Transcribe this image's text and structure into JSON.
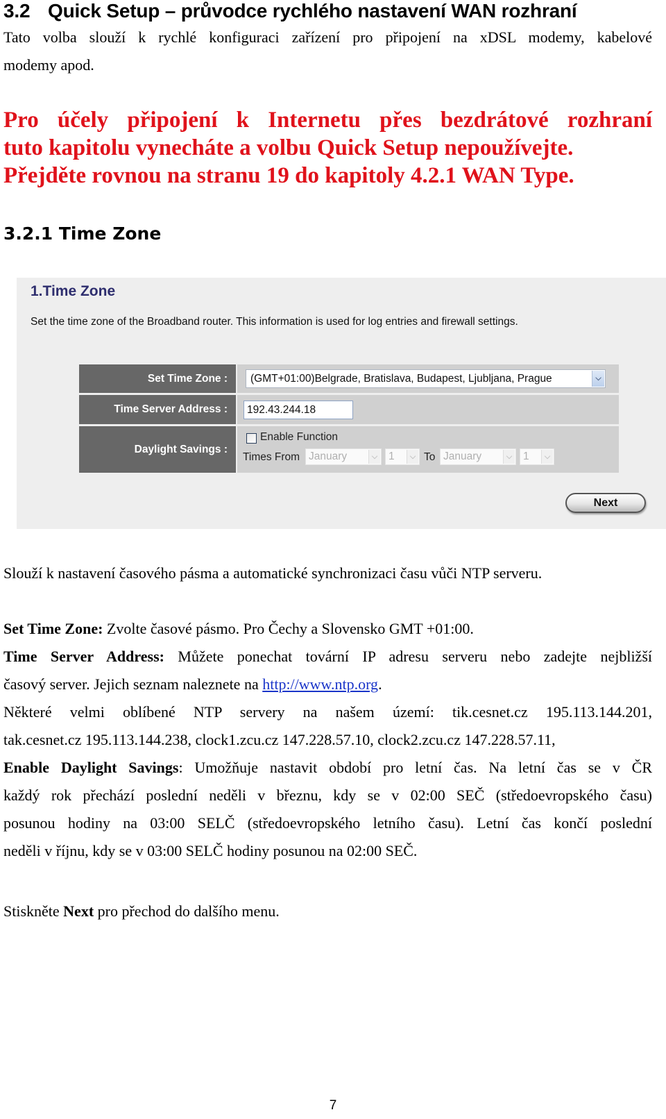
{
  "heading": {
    "number": "3.2",
    "title": "Quick Setup – průvodce rychlého nastavení WAN rozhraní"
  },
  "intro": {
    "line1": "Tato volba slouží k rychlé konfiguraci zařízení pro připojení na xDSL modemy, kabelové",
    "line2": "modemy apod."
  },
  "warning": {
    "line1": "Pro účely připojení k Internetu přes bezdrátové rozhraní",
    "line2": "tuto kapitolu vynecháte a volbu Quick Setup nepoužívejte.",
    "line3": "Přejděte rovnou na stranu 19 do kapitoly 4.2.1 WAN Type.",
    "color": "#e0121b"
  },
  "subheading": "3.2.1 Time Zone",
  "router_ui": {
    "title": "1.Time Zone",
    "description": "Set the time zone of the Broadband router. This information is used for log entries and firewall settings.",
    "rows": {
      "time_zone": {
        "label": "Set Time Zone :",
        "value": "(GMT+01:00)Belgrade, Bratislava, Budapest, Ljubljana, Prague"
      },
      "time_server": {
        "label": "Time Server Address :",
        "value": "192.43.244.18"
      },
      "daylight": {
        "label": "Daylight Savings :",
        "enable_label": "Enable Function",
        "enabled": false,
        "times_from_label": "Times From",
        "to_label": "To",
        "from_month": "January",
        "from_day": "1",
        "to_month": "January",
        "to_day": "1"
      }
    },
    "next_button": "Next",
    "colors": {
      "label_bg": "#676767",
      "value_bg": "#d0d0d0",
      "panel_bg": "#eeeeee",
      "title": "#2e2e6e"
    }
  },
  "body": {
    "p1": "Slouží k nastavení časového pásma a automatické synchronizaci času vůči NTP serveru.",
    "tz_term": "Set Time Zone:",
    "tz_text": " Zvolte časové pásmo. Pro Čechy a Slovensko GMT +01:00.",
    "ts_term": "Time Server Address:",
    "ts_text1": " Můžete ponechat tovární IP adresu serveru nebo zadejte nejbližší",
    "ts_text2": "časový server. Jejich seznam naleznete na ",
    "ts_link": "http://www.ntp.org",
    "ts_text3": ".",
    "ntp_line1": "Některé velmi oblíbené NTP servery na našem území: tik.cesnet.cz 195.113.144.201,",
    "ntp_line2": "tak.cesnet.cz 195.113.144.238,  clock1.zcu.cz 147.228.57.10, clock2.zcu.cz 147.228.57.11,",
    "dst_term": "Enable Daylight Savings",
    "dst_line1": ": Umožňuje nastavit období pro letní čas. Na letní čas se v ČR",
    "dst_line2": "každý rok přechází poslední neděli v březnu, kdy se v 02:00 SEČ (středoevropského času)",
    "dst_line3": "posunou hodiny na 03:00 SELČ (středoevropského letního času). Letní čas končí poslední",
    "dst_line4": "neděli v říjnu, kdy se v 03:00 SELČ hodiny posunou na 02:00 SEČ.",
    "next_pre": "Stiskněte ",
    "next_term": "Next",
    "next_post": " pro přechod do dalšího menu."
  },
  "page_number": "7"
}
